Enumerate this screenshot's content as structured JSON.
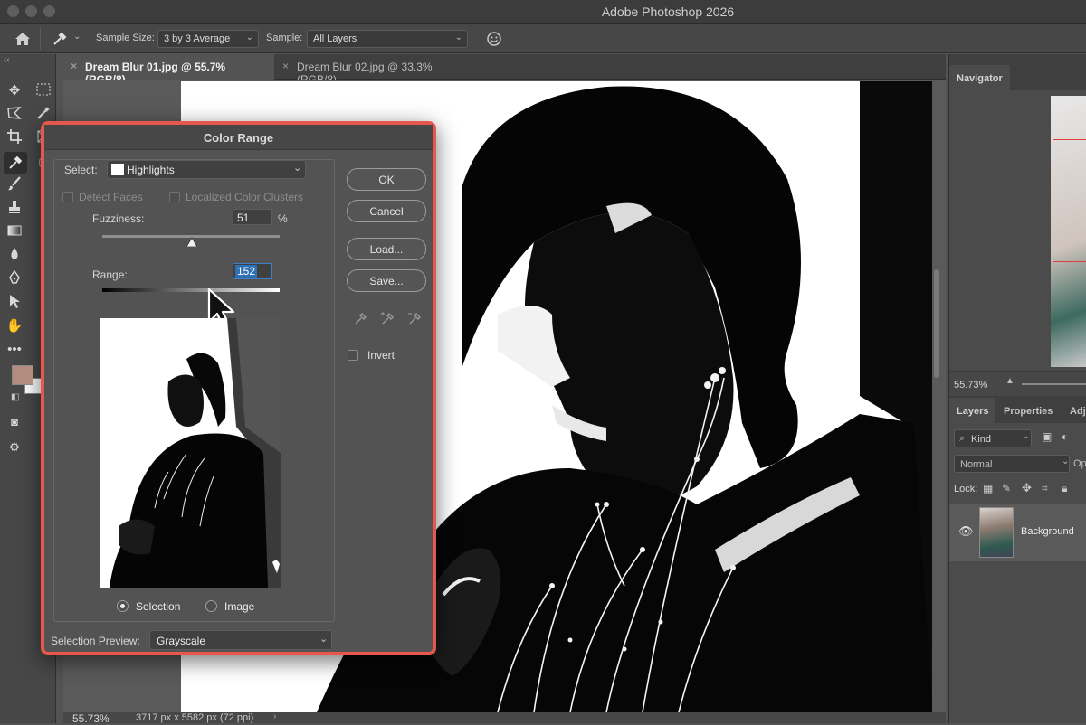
{
  "app": {
    "title": "Adobe Photoshop 2026"
  },
  "options_bar": {
    "sample_size_label": "Sample Size:",
    "sample_size_value": "3 by 3 Average",
    "sample_label": "Sample:",
    "sample_value": "All Layers"
  },
  "tabs": [
    {
      "label": "Dream Blur 01.jpg @ 55.7% (RGB/8)",
      "active": true
    },
    {
      "label": "Dream Blur 02.jpg @ 33.3% (RGB/8)",
      "active": false
    }
  ],
  "status_bar": {
    "zoom": "55.73%",
    "doc_info": "3717 px x 5582 px (72 ppi)"
  },
  "navigator": {
    "tab": "Navigator",
    "zoom": "55.73%"
  },
  "layers_panel": {
    "tabs": [
      "Layers",
      "Properties",
      "Adju"
    ],
    "kind_label": "Kind",
    "blend_mode": "Normal",
    "opacity_label": "Op",
    "lock_label": "Lock:",
    "layer_name": "Background"
  },
  "dialog": {
    "title": "Color Range",
    "select_label": "Select:",
    "select_value": "Highlights",
    "detect_faces": "Detect Faces",
    "localized_clusters": "Localized Color Clusters",
    "fuzziness_label": "Fuzziness:",
    "fuzziness_value": "51",
    "fuzziness_unit": "%",
    "range_label": "Range:",
    "range_value": "152",
    "ok": "OK",
    "cancel": "Cancel",
    "load": "Load...",
    "save": "Save...",
    "invert": "Invert",
    "radio_selection": "Selection",
    "radio_image": "Image",
    "selection_preview_label": "Selection Preview:",
    "selection_preview_value": "Grayscale"
  },
  "colors": {
    "dialog_border": "#e6584b",
    "foreground_swatch": "#b28c7e",
    "background_swatch": "#ffffff"
  }
}
